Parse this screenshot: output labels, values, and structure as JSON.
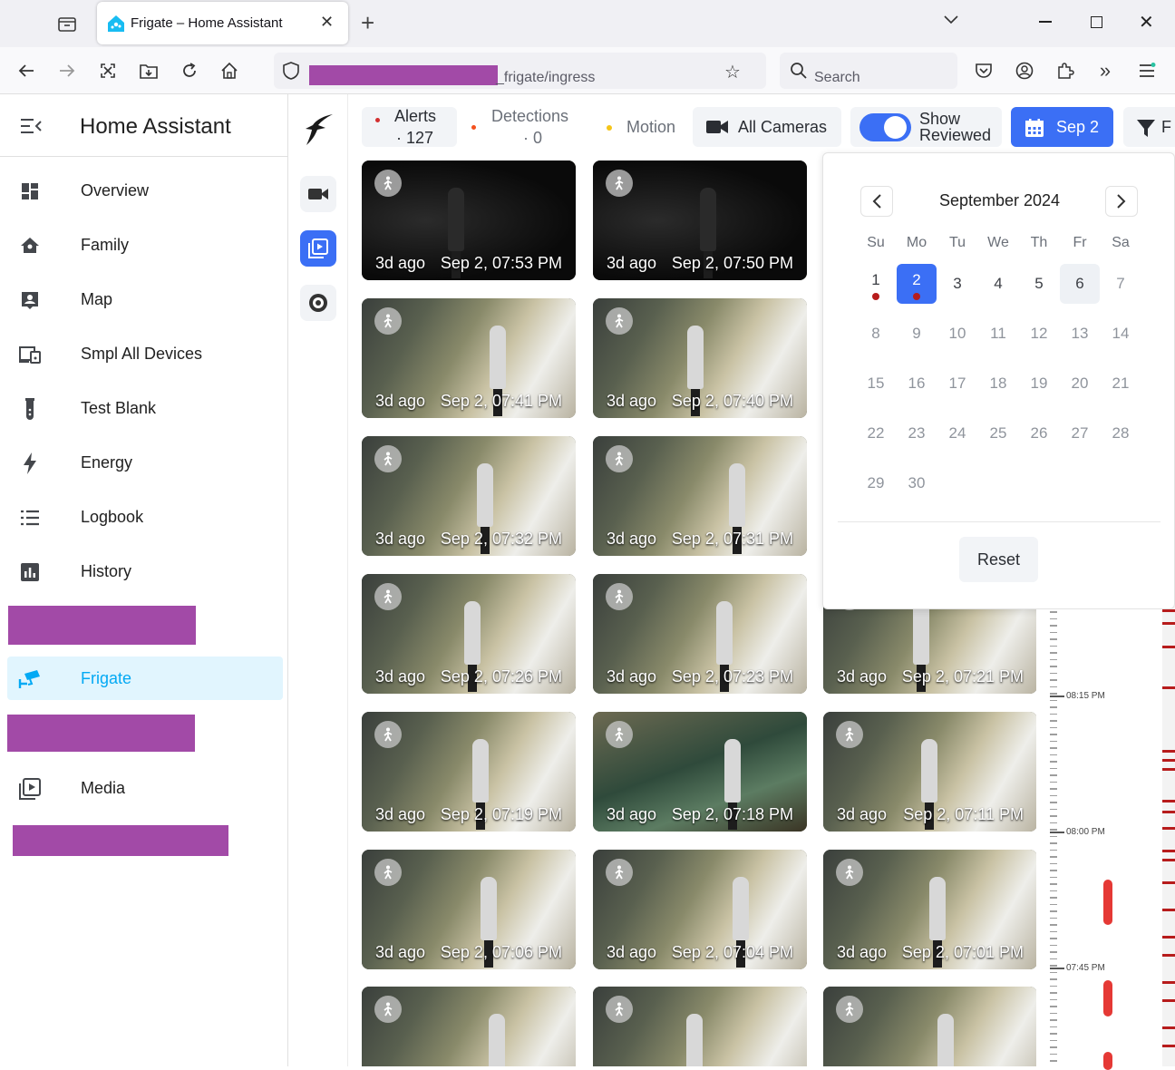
{
  "browser": {
    "tab_title": "Frigate – Home Assistant",
    "new_tab": "+",
    "url_suffix": "_frigate/ingress",
    "search_placeholder": "Search"
  },
  "sidebar": {
    "title": "Home Assistant",
    "items": [
      {
        "label": "Overview",
        "icon": "dashboard-icon"
      },
      {
        "label": "Family",
        "icon": "home-icon"
      },
      {
        "label": "Map",
        "icon": "map-account-icon"
      },
      {
        "label": "Smpl All Devices",
        "icon": "devices-icon"
      },
      {
        "label": "Test Blank",
        "icon": "flask-icon"
      },
      {
        "label": "Energy",
        "icon": "lightning-icon"
      },
      {
        "label": "Logbook",
        "icon": "list-icon"
      },
      {
        "label": "History",
        "icon": "chart-icon"
      },
      {
        "label": "Frigate",
        "icon": "cctv-icon",
        "active": true
      },
      {
        "label": "Media",
        "icon": "media-icon"
      }
    ]
  },
  "toolbar": {
    "alerts_label": "Alerts",
    "alerts_count": "· 127",
    "detections_label": "Detections",
    "detections_count": "· 0",
    "motion_label": "Motion",
    "cameras_label": "All Cameras",
    "show_reviewed_1": "Show",
    "show_reviewed_2": "Reviewed",
    "date_label": "Sep 2",
    "filter_label": "F"
  },
  "calendar": {
    "month": "September 2024",
    "dows": [
      "Su",
      "Mo",
      "Tu",
      "We",
      "Th",
      "Fr",
      "Sa"
    ],
    "days": [
      "1",
      "2",
      "3",
      "4",
      "5",
      "6",
      "7",
      "8",
      "9",
      "10",
      "11",
      "12",
      "13",
      "14",
      "15",
      "16",
      "17",
      "18",
      "19",
      "20",
      "21",
      "22",
      "23",
      "24",
      "25",
      "26",
      "27",
      "28",
      "29",
      "30"
    ],
    "selected": "2",
    "today": "6",
    "reset_label": "Reset"
  },
  "cards": [
    {
      "ago": "3d ago",
      "when": "Sep 2, 07:53 PM"
    },
    {
      "ago": "3d ago",
      "when": "Sep 2, 07:50 PM"
    },
    {
      "ago": "3d ago",
      "when": "Sep 2, 07:41 PM"
    },
    {
      "ago": "3d ago",
      "when": "Sep 2, 07:40 PM"
    },
    {
      "ago": "3d ago",
      "when": "Sep 2, 07:32 PM"
    },
    {
      "ago": "3d ago",
      "when": "Sep 2, 07:31 PM"
    },
    {
      "ago": "3d ago",
      "when": "Sep 2, 07:26 PM"
    },
    {
      "ago": "3d ago",
      "when": "Sep 2, 07:23 PM"
    },
    {
      "ago": "3d ago",
      "when": "Sep 2, 07:21 PM"
    },
    {
      "ago": "3d ago",
      "when": "Sep 2, 07:19 PM"
    },
    {
      "ago": "3d ago",
      "when": "Sep 2, 07:18 PM"
    },
    {
      "ago": "3d ago",
      "when": "Sep 2, 07:11 PM"
    },
    {
      "ago": "3d ago",
      "when": "Sep 2, 07:06 PM"
    },
    {
      "ago": "3d ago",
      "when": "Sep 2, 07:04 PM"
    },
    {
      "ago": "3d ago",
      "when": "Sep 2, 07:01 PM"
    },
    {
      "ago": "",
      "when": ""
    },
    {
      "ago": "",
      "when": ""
    },
    {
      "ago": "",
      "when": ""
    }
  ],
  "timeline": {
    "labels": [
      "08:15 PM",
      "08:00 PM",
      "07:45 PM"
    ]
  },
  "colors": {
    "accent": "#03a9f4",
    "active_bg": "#e1f5fe",
    "primary_blue": "#3b6ff5",
    "alert_red": "#d32f2f",
    "redaction": "#a24aa7"
  }
}
